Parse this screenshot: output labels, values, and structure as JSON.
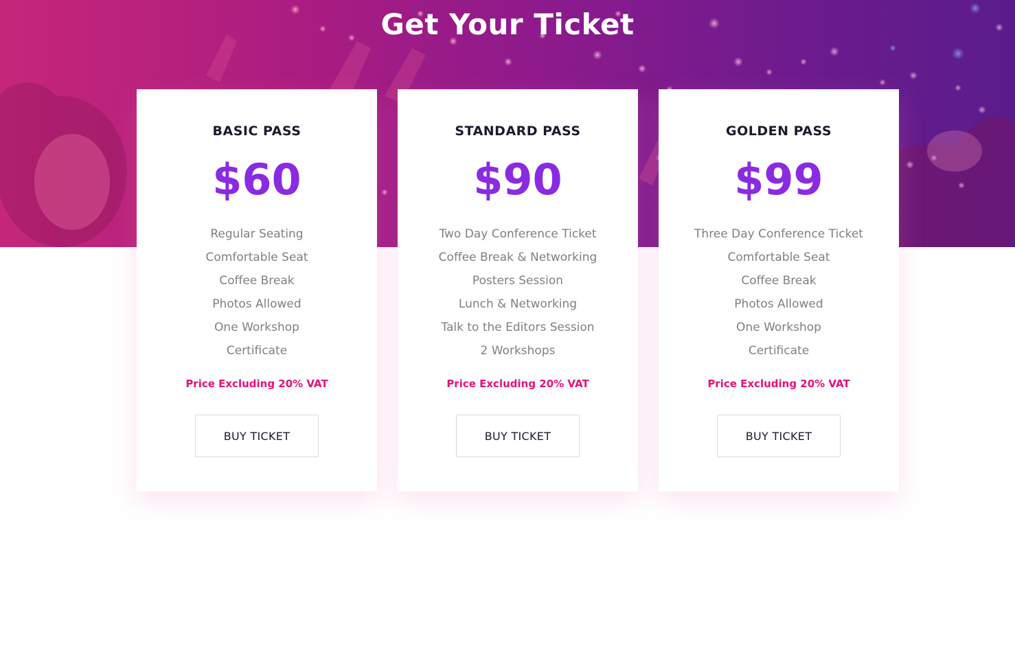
{
  "section": {
    "title": "Get Your Ticket"
  },
  "colors": {
    "accent_price": "#8a2be2",
    "accent_vat": "#e8117a",
    "hero_left": "#b5237a",
    "hero_right": "#5a1c8c",
    "title_text": "#1a1a2e",
    "feature_text": "#808080"
  },
  "tickets": [
    {
      "name": "BASIC PASS",
      "price": "$60",
      "features": [
        "Regular Seating",
        "Comfortable Seat",
        "Coffee Break",
        "Photos Allowed",
        "One Workshop",
        "Certificate"
      ],
      "vat_note": "Price Excluding 20% VAT",
      "button_label": "BUY TICKET"
    },
    {
      "name": "STANDARD PASS",
      "price": "$90",
      "features": [
        "Two Day Conference Ticket",
        "Coffee Break & Networking",
        "Posters Session",
        "Lunch & Networking",
        "Talk to the Editors Session",
        "2 Workshops"
      ],
      "vat_note": "Price Excluding 20% VAT",
      "button_label": "BUY TICKET"
    },
    {
      "name": "GOLDEN PASS",
      "price": "$99",
      "features": [
        "Three Day Conference Ticket",
        "Comfortable Seat",
        "Coffee Break",
        "Photos Allowed",
        "One Workshop",
        "Certificate"
      ],
      "vat_note": "Price Excluding 20% VAT",
      "button_label": "BUY TICKET"
    }
  ]
}
